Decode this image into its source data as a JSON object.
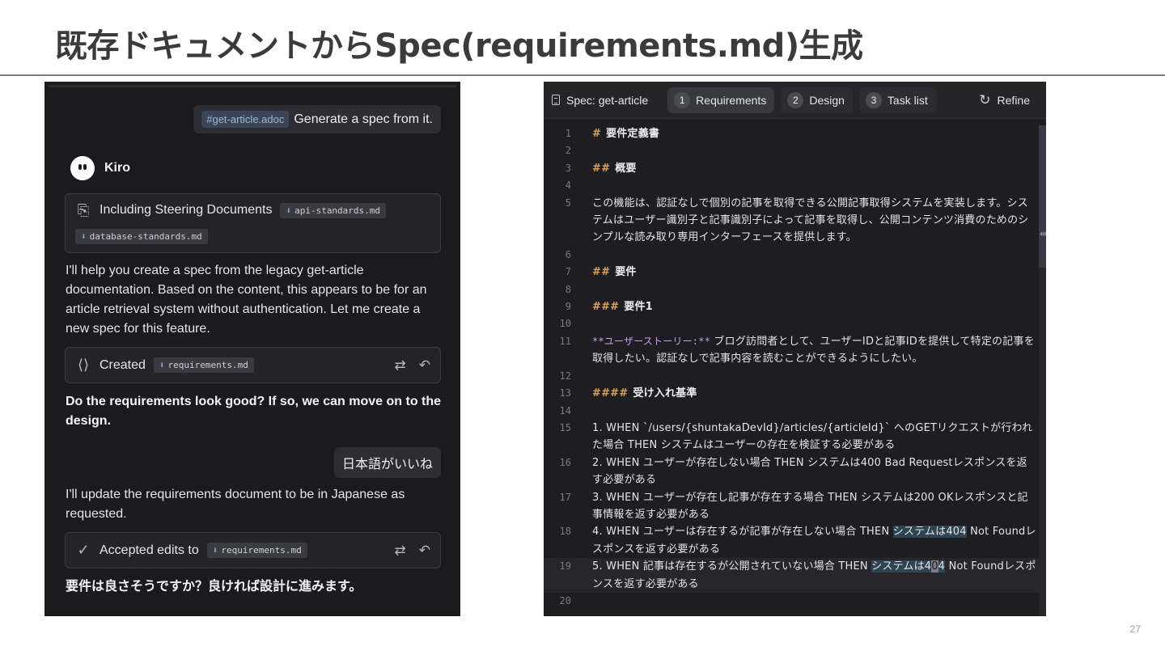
{
  "slide": {
    "title": "既存ドキュメントからSpec(requirements.md)生成",
    "page_number": "27"
  },
  "chat": {
    "user_message_1": {
      "context_chip": "#get-article.adoc",
      "text": "Generate a spec from it."
    },
    "agent_name": "Kiro",
    "steering_card": {
      "label": "Including Steering Documents",
      "files": [
        "api-standards.md",
        "database-standards.md"
      ]
    },
    "reply_1": "I'll help you create a spec from the legacy get-article documentation. Based on the content, this appears to be for an article retrieval system without authentication. Let me create a new spec for this feature.",
    "created_card": {
      "label": "Created",
      "file": "requirements.md"
    },
    "question_1": "Do the requirements look good? If so, we can move on to the design.",
    "user_message_2": "日本語がいいね",
    "reply_2": "I'll update the requirements document to be in Japanese as requested.",
    "accepted_card": {
      "label": "Accepted edits to",
      "file": "requirements.md"
    },
    "question_2": "要件は良さそうですか？良ければ設計に進みます。"
  },
  "editor": {
    "spec_title": "Spec: get-article",
    "tabs": [
      {
        "num": "1",
        "label": "Requirements",
        "active": true
      },
      {
        "num": "2",
        "label": "Design",
        "active": false
      },
      {
        "num": "3",
        "label": "Task list",
        "active": false
      }
    ],
    "refine_label": "Refine",
    "lines": {
      "l1": {
        "n": "1",
        "mark": "#",
        "text": "要件定義書"
      },
      "l2": {
        "n": "2"
      },
      "l3": {
        "n": "3",
        "mark": "##",
        "text": "概要"
      },
      "l4": {
        "n": "4"
      },
      "l5": {
        "n": "5",
        "text": "この機能は、認証なしで個別の記事を取得できる公開記事取得システムを実装します。システムはユーザー識別子と記事識別子によって記事を取得し、公開コンテンツ消費のためのシンプルな読み取り専用インターフェースを提供します。"
      },
      "l6": {
        "n": "6"
      },
      "l7": {
        "n": "7",
        "mark": "##",
        "text": "要件"
      },
      "l8": {
        "n": "8"
      },
      "l9": {
        "n": "9",
        "mark": "###",
        "text": "要件1"
      },
      "l10": {
        "n": "10"
      },
      "l11": {
        "n": "11",
        "story": "**ユーザーストーリー:**",
        "text": " ブログ訪問者として、ユーザーIDと記事IDを提供して特定の記事を取得したい。認証なしで記事内容を読むことができるようにしたい。"
      },
      "l12": {
        "n": "12"
      },
      "l13": {
        "n": "13",
        "mark": "####",
        "text": "受け入れ基準"
      },
      "l14": {
        "n": "14"
      },
      "l15": {
        "n": "15",
        "text": "1. WHEN `/users/{shuntakaDevId}/articles/{articleId}` へのGETリクエストが行われた場合 THEN システムはユーザーの存在を検証する必要がある"
      },
      "l16": {
        "n": "16",
        "text": "2. WHEN ユーザーが存在しない場合 THEN システムは400 Bad Requestレスポンスを返す必要がある"
      },
      "l17": {
        "n": "17",
        "text": "3. WHEN ユーザーが存在し記事が存在する場合 THEN システムは200 OKレスポンスと記事情報を返す必要がある"
      },
      "l18": {
        "n": "18",
        "pre": "4. WHEN ユーザーは存在するが記事が存在しない場合 THEN ",
        "sel": "システムは404",
        "post": " Not Foundレスポンスを返す必要がある"
      },
      "l19": {
        "n": "19",
        "pre": "5. WHEN 記事は存在するが公開されていない場合 THEN ",
        "sel": "システムは4",
        "cursor": "0",
        "sel2": "4",
        "post": " Not Foundレスポンスを返す必要がある"
      },
      "l20": {
        "n": "20"
      }
    }
  }
}
